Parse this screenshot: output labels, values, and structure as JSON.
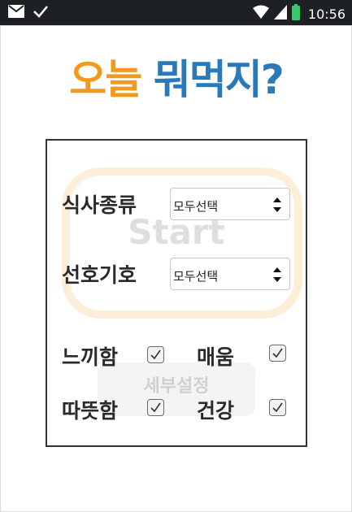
{
  "status_bar": {
    "time": "10:56",
    "icons": [
      "mail-icon",
      "check-icon",
      "wifi-icon",
      "signal-icon",
      "battery-icon"
    ],
    "battery_color": "#38c96f"
  },
  "title": {
    "part1": "오늘",
    "part2": "뭐먹지?",
    "color1": "#f29a1e",
    "color2": "#2a7aba"
  },
  "panel": {
    "start_label": "Start",
    "detail_label": "세부설정",
    "meal_type": {
      "label": "식사종류",
      "selected": "모두선택"
    },
    "preference": {
      "label": "선호기호",
      "selected": "모두선택"
    },
    "checkboxes": [
      {
        "label": "느끼함",
        "checked": true
      },
      {
        "label": "매움",
        "checked": true
      },
      {
        "label": "따뜻함",
        "checked": true
      },
      {
        "label": "건강",
        "checked": true
      }
    ]
  }
}
